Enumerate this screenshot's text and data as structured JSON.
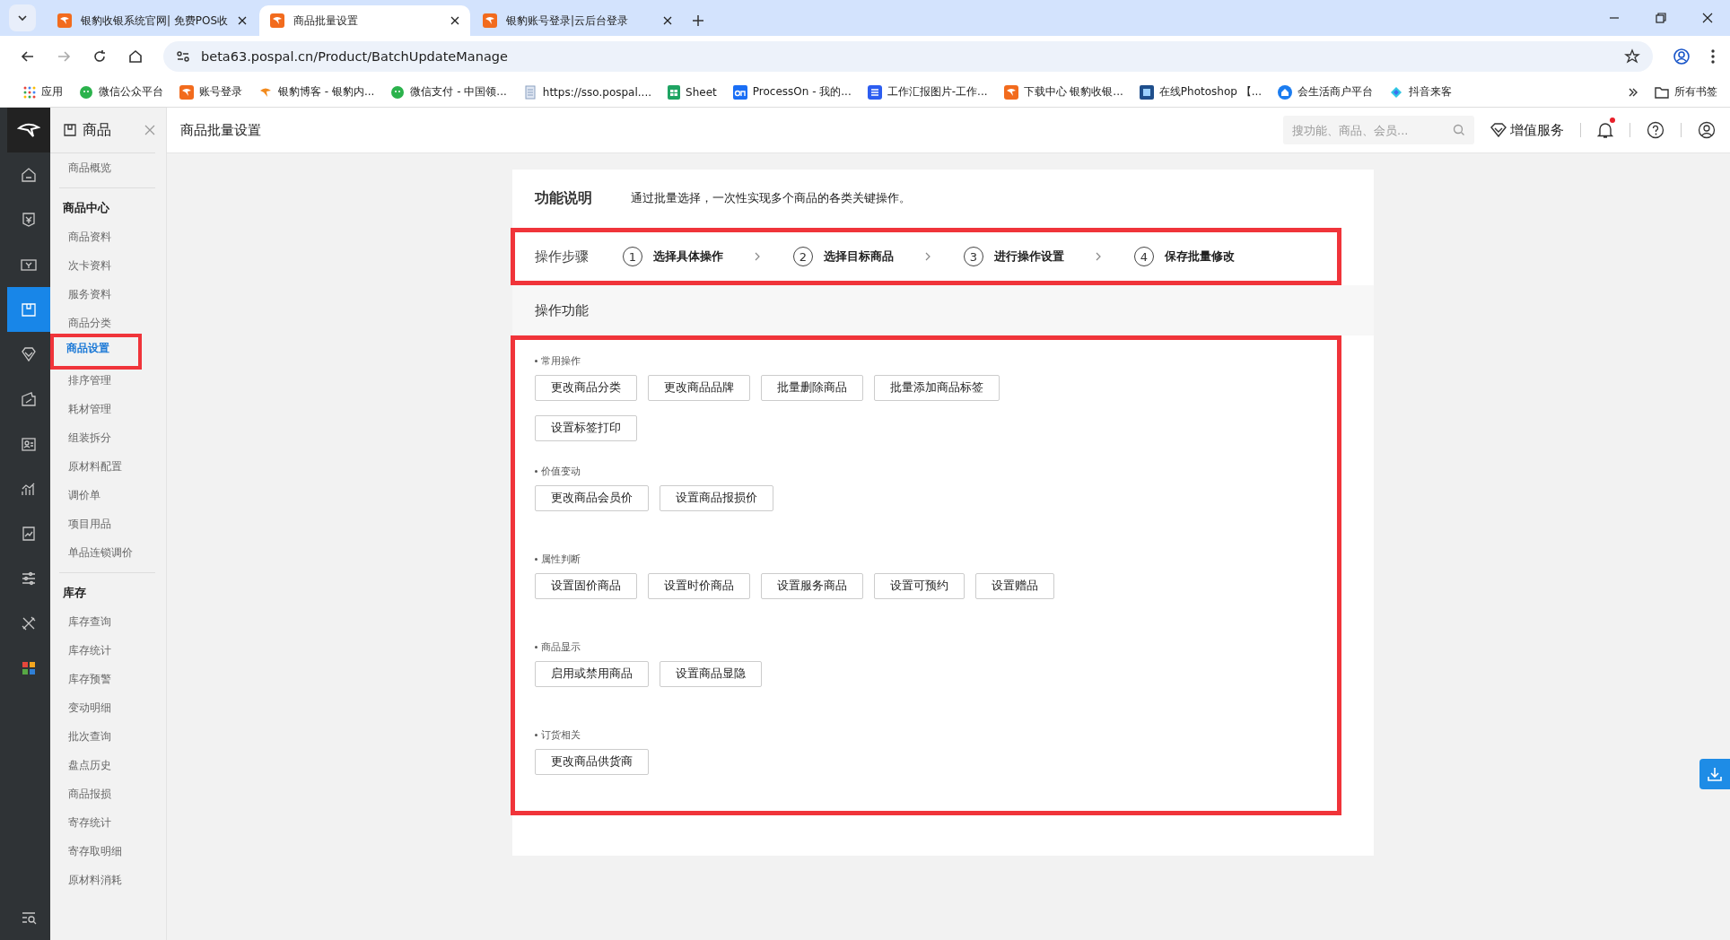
{
  "browser": {
    "tabs": [
      {
        "title": "银豹收银系统官网| 免费POS收",
        "selected": false
      },
      {
        "title": "商品批量设置",
        "selected": true
      },
      {
        "title": "银豹账号登录|云后台登录",
        "selected": false
      }
    ],
    "url": "beta63.pospal.cn/Product/BatchUpdateManage",
    "bookmarks": [
      {
        "label": "应用",
        "kind": "apps"
      },
      {
        "label": "微信公众平台",
        "kind": "wechat"
      },
      {
        "label": "账号登录",
        "kind": "pospal"
      },
      {
        "label": "银豹博客 - 银豹内...",
        "kind": "leopard"
      },
      {
        "label": "微信支付 - 中国领...",
        "kind": "wechat"
      },
      {
        "label": "https://sso.pospal....",
        "kind": "doc"
      },
      {
        "label": "Sheet",
        "kind": "sheet"
      },
      {
        "label": "ProcessOn - 我的...",
        "kind": "on"
      },
      {
        "label": "工作汇报图片-工作...",
        "kind": "blue"
      },
      {
        "label": "下载中心 银豹收银...",
        "kind": "pospal"
      },
      {
        "label": "在线Photoshop 【...",
        "kind": "ps"
      },
      {
        "label": "会生活商户平台",
        "kind": "home"
      },
      {
        "label": "抖音来客",
        "kind": "douyin"
      }
    ],
    "all_bookmarks": "所有书签"
  },
  "rail": [
    {
      "selected": false
    },
    {
      "selected": false
    },
    {
      "selected": false
    },
    {
      "selected": true
    },
    {
      "selected": false
    },
    {
      "selected": false
    },
    {
      "selected": false
    },
    {
      "selected": false
    },
    {
      "selected": false
    },
    {
      "selected": false
    },
    {
      "selected": false
    },
    {
      "selected": false
    }
  ],
  "sidebar": {
    "title": "商品",
    "top_items": [
      {
        "label": "商品概览",
        "selected": false,
        "highlighted": false
      }
    ],
    "groups": [
      {
        "title": "商品中心",
        "items": [
          {
            "label": "商品资料",
            "selected": false,
            "highlighted": false
          },
          {
            "label": "次卡资料",
            "selected": false,
            "highlighted": false
          },
          {
            "label": "服务资料",
            "selected": false,
            "highlighted": false
          },
          {
            "label": "商品分类",
            "selected": false,
            "highlighted": false
          },
          {
            "label": "商品设置",
            "selected": true,
            "highlighted": true
          },
          {
            "label": "排序管理",
            "selected": false,
            "highlighted": false
          },
          {
            "label": "耗材管理",
            "selected": false,
            "highlighted": false
          },
          {
            "label": "组装拆分",
            "selected": false,
            "highlighted": false
          },
          {
            "label": "原材料配置",
            "selected": false,
            "highlighted": false
          },
          {
            "label": "调价单",
            "selected": false,
            "highlighted": false
          },
          {
            "label": "项目用品",
            "selected": false,
            "highlighted": false
          },
          {
            "label": "单品连锁调价",
            "selected": false,
            "highlighted": false
          }
        ]
      },
      {
        "title": "库存",
        "items": [
          {
            "label": "库存查询",
            "selected": false,
            "highlighted": false
          },
          {
            "label": "库存统计",
            "selected": false,
            "highlighted": false
          },
          {
            "label": "库存预警",
            "selected": false,
            "highlighted": false
          },
          {
            "label": "变动明细",
            "selected": false,
            "highlighted": false
          },
          {
            "label": "批次查询",
            "selected": false,
            "highlighted": false
          },
          {
            "label": "盘点历史",
            "selected": false,
            "highlighted": false
          },
          {
            "label": "商品报损",
            "selected": false,
            "highlighted": false
          },
          {
            "label": "寄存统计",
            "selected": false,
            "highlighted": false
          },
          {
            "label": "寄存取明细",
            "selected": false,
            "highlighted": false
          },
          {
            "label": "原材料消耗",
            "selected": false,
            "highlighted": false
          }
        ]
      }
    ]
  },
  "header": {
    "page_title": "商品批量设置",
    "search": {
      "placeholder": "搜功能、商品、会员..."
    },
    "value_added": "增值服务",
    "has_notification": true
  },
  "description": {
    "title": "功能说明",
    "text": "通过批量选择，一次性实现多个商品的各类关键操作。"
  },
  "steps": {
    "title": "操作步骤",
    "highlighted": true,
    "items": [
      {
        "number": "1",
        "label": "选择具体操作"
      },
      {
        "number": "2",
        "label": "选择目标商品"
      },
      {
        "number": "3",
        "label": "进行操作设置"
      },
      {
        "number": "4",
        "label": "保存批量修改"
      }
    ]
  },
  "functions": {
    "title": "操作功能",
    "highlighted": true,
    "groups": [
      {
        "title": "常用操作",
        "buttons": [
          "更改商品分类",
          "更改商品品牌",
          "批量删除商品",
          "批量添加商品标签",
          "设置标签打印"
        ]
      },
      {
        "title": "价值变动",
        "buttons": [
          "更改商品会员价",
          "设置商品报损价"
        ]
      },
      {
        "title": "属性判断",
        "buttons": [
          "设置固价商品",
          "设置时价商品",
          "设置服务商品",
          "设置可预约",
          "设置赠品"
        ]
      },
      {
        "title": "商品显示",
        "buttons": [
          "启用或禁用商品",
          "设置商品显隐"
        ]
      },
      {
        "title": "订货相关",
        "buttons": [
          "更改商品供货商"
        ]
      }
    ]
  }
}
